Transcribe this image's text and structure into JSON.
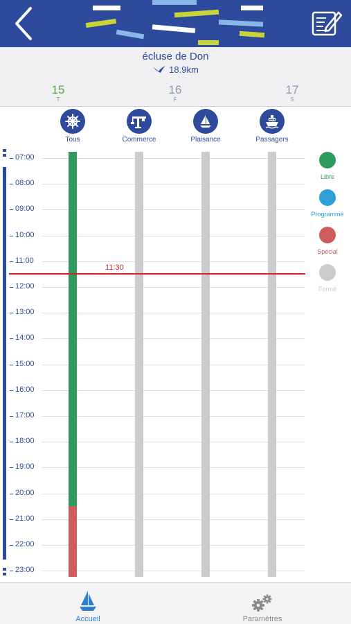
{
  "header": {
    "back_icon": "chevron-left-icon",
    "edit_icon": "edit-form-icon",
    "banner_colors": [
      "#ffffff",
      "#c8d43a",
      "#8ab7e8"
    ]
  },
  "lock": {
    "name": "écluse de Don",
    "distance": "18.9km",
    "distance_icon": "swallow-icon"
  },
  "days": [
    {
      "num": "15",
      "letter": "T",
      "color": "#5aa54a"
    },
    {
      "num": "16",
      "letter": "F",
      "color": "#8a96b8"
    },
    {
      "num": "17",
      "letter": "S",
      "color": "#8a96b8"
    }
  ],
  "categories": [
    {
      "label": "Tous",
      "icon": "ship-wheel-icon"
    },
    {
      "label": "Commerce",
      "icon": "crane-icon"
    },
    {
      "label": "Plaisance",
      "icon": "sailboat-icon"
    },
    {
      "label": "Passagers",
      "icon": "passenger-ship-icon"
    }
  ],
  "hours": [
    "07:00",
    "08:00",
    "09:00",
    "10:00",
    "11:00",
    "12:00",
    "13:00",
    "14:00",
    "15:00",
    "16:00",
    "17:00",
    "18:00",
    "19:00",
    "20:00",
    "21:00",
    "22:00",
    "23:00"
  ],
  "now": {
    "label": "11:30",
    "hour": 11.5,
    "color": "#d9232a"
  },
  "legend": [
    {
      "label": "Libre",
      "color": "#2e9a5e"
    },
    {
      "label": "Programmé",
      "color": "#2f9fd8"
    },
    {
      "label": "Spécial",
      "color": "#d05c5c"
    },
    {
      "label": "Fermé",
      "color": "#cccccc"
    }
  ],
  "schedule": {
    "Tous": [
      {
        "from": 6.75,
        "to": 20.5,
        "status": "Libre"
      },
      {
        "from": 20.5,
        "to": 23.25,
        "status": "Spécial"
      }
    ],
    "Commerce": [
      {
        "from": 6.75,
        "to": 23.25,
        "status": "Fermé"
      }
    ],
    "Plaisance": [
      {
        "from": 6.75,
        "to": 23.25,
        "status": "Fermé"
      }
    ],
    "Passagers": [
      {
        "from": 6.75,
        "to": 23.25,
        "status": "Fermé"
      }
    ]
  },
  "tabs": [
    {
      "label": "Accueil",
      "icon": "sailboat-icon",
      "active": true,
      "color": "#2f7fd0"
    },
    {
      "label": "Paramètres",
      "icon": "gears-icon",
      "active": false,
      "color": "#8a8a8a"
    }
  ]
}
